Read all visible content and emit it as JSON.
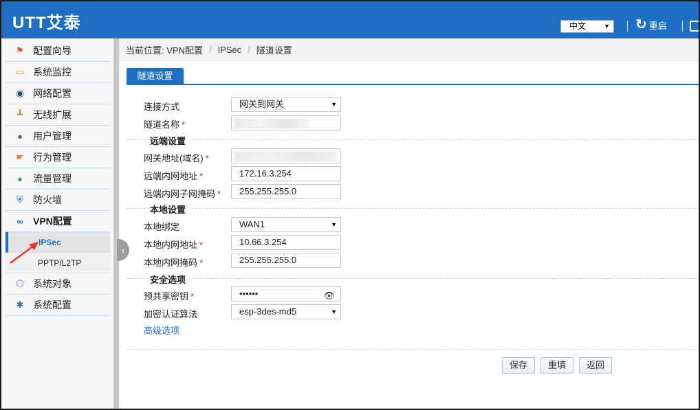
{
  "header": {
    "logo": "UTT艾泰",
    "language": "中文",
    "restart_label": "重启"
  },
  "sidebar": {
    "items": [
      {
        "label": "配置向导",
        "icon": "wizard-icon"
      },
      {
        "label": "系统监控",
        "icon": "monitor-icon"
      },
      {
        "label": "网络配置",
        "icon": "network-icon"
      },
      {
        "label": "无线扩展",
        "icon": "wireless-icon"
      },
      {
        "label": "用户管理",
        "icon": "users-icon"
      },
      {
        "label": "行为管理",
        "icon": "hand-icon"
      },
      {
        "label": "流量管理",
        "icon": "traffic-icon"
      },
      {
        "label": "防火墙",
        "icon": "shield-icon"
      },
      {
        "label": "VPN配置",
        "icon": "vpn-icon"
      },
      {
        "label": "系统对象",
        "icon": "cube-icon"
      },
      {
        "label": "系统配置",
        "icon": "gear-icon"
      }
    ],
    "vpn_sub": [
      {
        "label": "IPSec",
        "active": true
      },
      {
        "label": "PPTP/L2TP",
        "active": false
      }
    ]
  },
  "breadcrumb": {
    "prefix": "当前位置: VPN配置",
    "level2": "IPSec",
    "level3": "隧道设置"
  },
  "tab": {
    "label": "隧道设置"
  },
  "form": {
    "connection_mode": {
      "label": "连接方式",
      "value": "网关到网关"
    },
    "tunnel_name": {
      "label": "隧道名称"
    },
    "remote_section": "远端设置",
    "gateway_addr": {
      "label": "网关地址(域名)"
    },
    "remote_lan_addr": {
      "label": "远端内网地址",
      "value": "172.16.3.254"
    },
    "remote_lan_mask": {
      "label": "远端内网子网掩码",
      "value": "255.255.255.0"
    },
    "local_section": "本地设置",
    "local_bind": {
      "label": "本地绑定",
      "value": "WAN1"
    },
    "local_lan_addr": {
      "label": "本地内网地址",
      "value": "10.66.3.254"
    },
    "local_lan_mask": {
      "label": "本地内网掩码",
      "value": "255.255.255.0"
    },
    "security_section": "安全选项",
    "psk": {
      "label": "预共享密钥",
      "value": "••••••"
    },
    "auth_algo": {
      "label": "加密认证算法",
      "value": "esp-3des-md5"
    },
    "advanced_link": "高级选项",
    "required_mark": "*"
  },
  "buttons": {
    "save": "保存",
    "reset": "重填",
    "back": "返回"
  },
  "colors": {
    "brand": "#1c6fc2",
    "required": "#e0271e",
    "annotation_arrow": "#e53935"
  }
}
